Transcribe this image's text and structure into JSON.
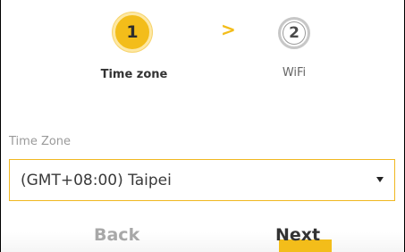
{
  "steps": [
    {
      "number": "1",
      "label": "Time zone",
      "state": "active"
    },
    {
      "number": "2",
      "label": "WiFi",
      "state": "inactive"
    }
  ],
  "step_separator": ">",
  "time_zone": {
    "label": "Time Zone",
    "selected": "(GMT+08:00) Taipei"
  },
  "buttons": {
    "back": "Back",
    "next": "Next"
  },
  "colors": {
    "accent": "#f3bd1a",
    "inactive": "#a8a8a8"
  }
}
